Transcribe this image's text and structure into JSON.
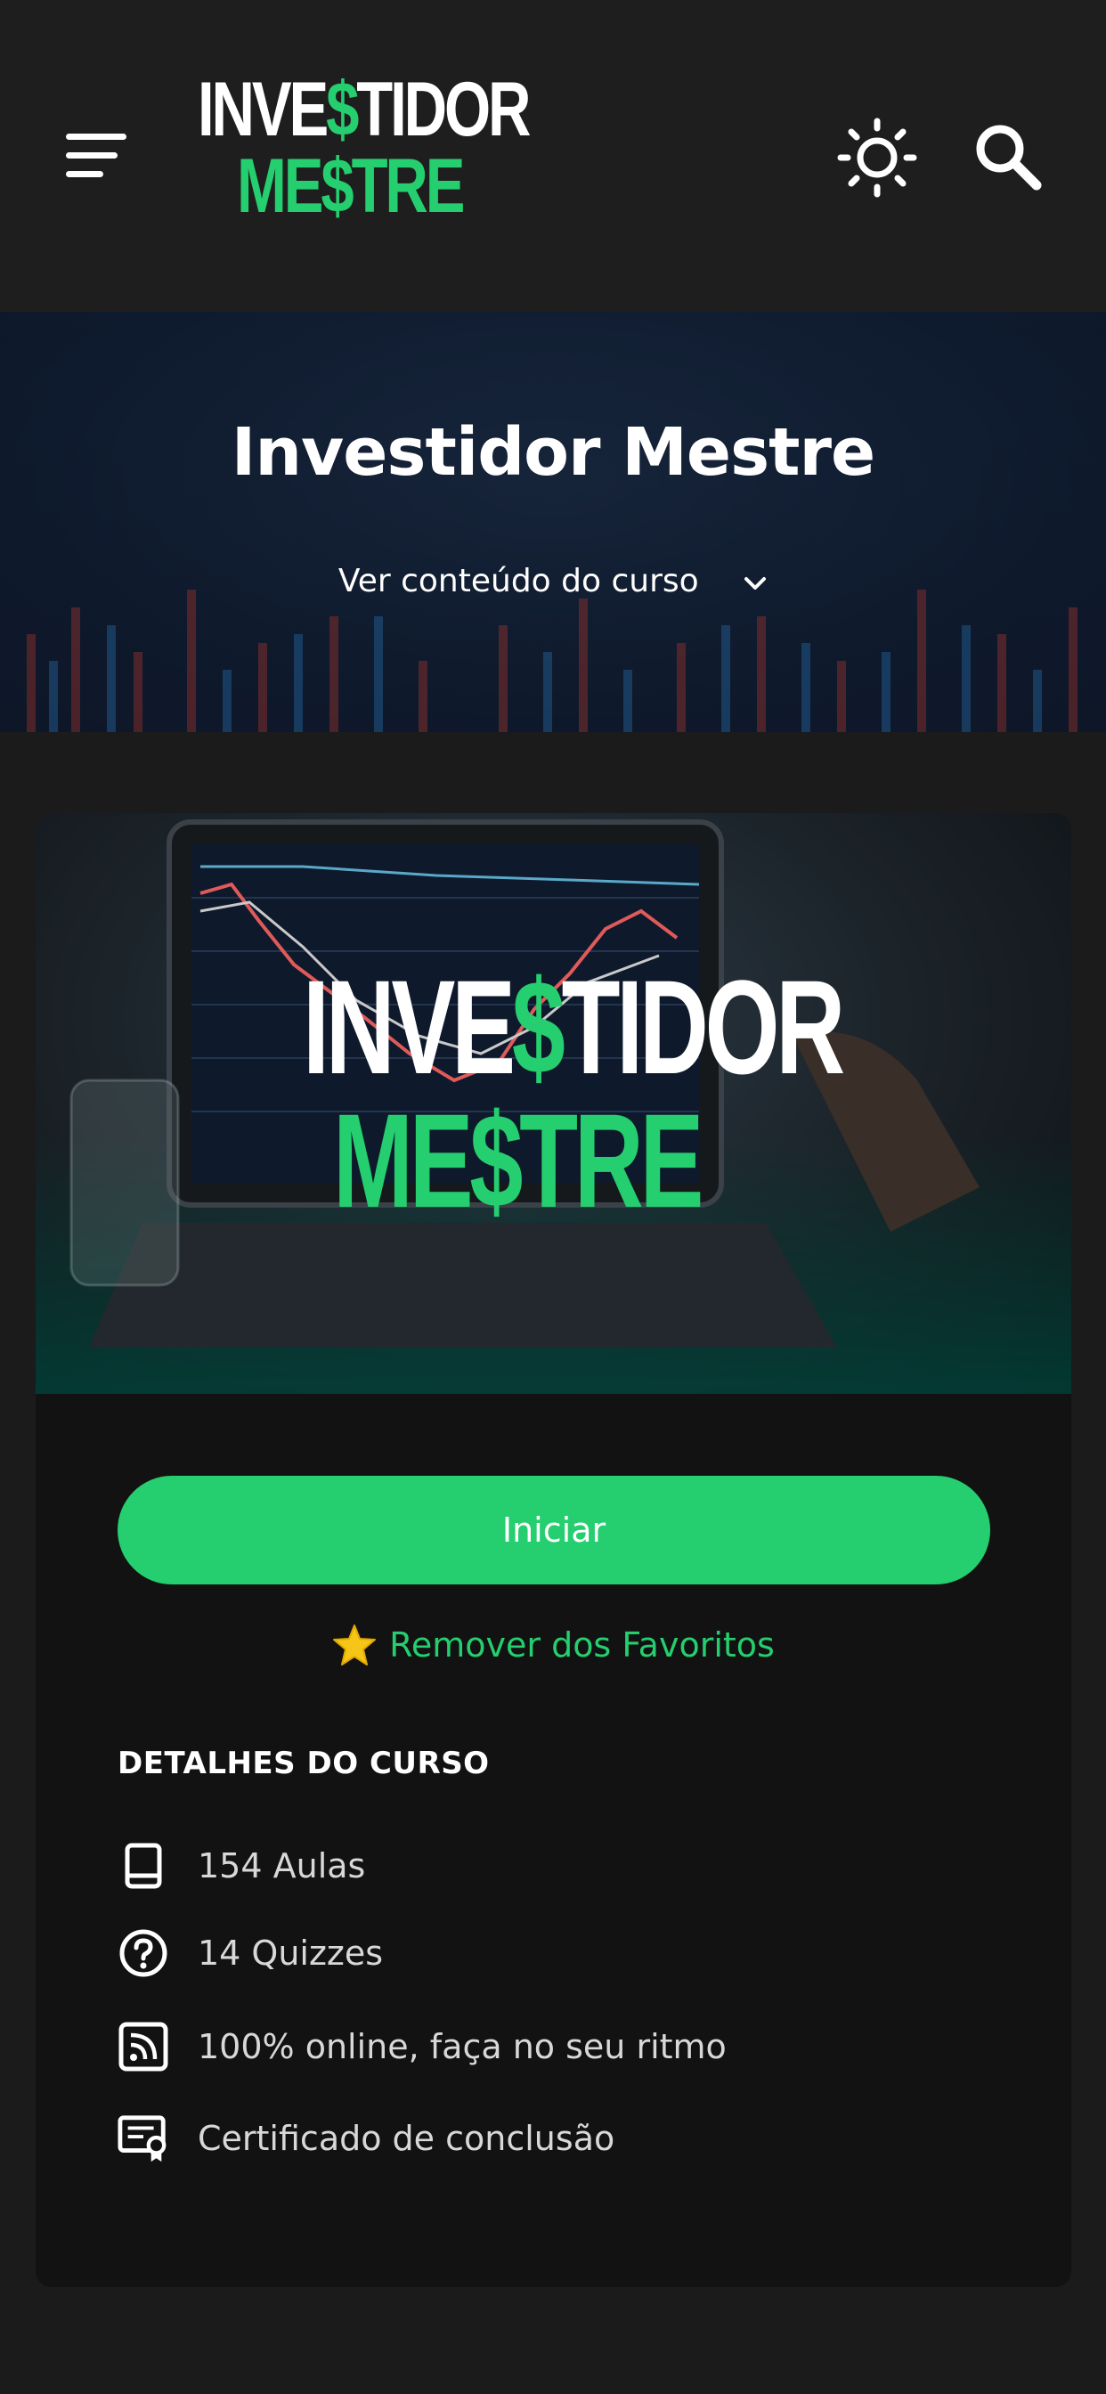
{
  "header": {
    "logo_top": [
      "INVE",
      "$",
      "TIDOR"
    ],
    "logo_bottom": [
      "ME",
      "$",
      "TRE"
    ],
    "icons": [
      "menu-icon",
      "sun-icon",
      "search-icon"
    ]
  },
  "banner": {
    "title": "Investidor Mestre",
    "toggle_label": "Ver conteúdo do curso"
  },
  "course": {
    "thumbnail_logo_top": [
      "INVE",
      "$",
      "TIDOR"
    ],
    "thumbnail_logo_bottom": [
      "ME",
      "$",
      "TRE"
    ],
    "start_label": "Iniciar",
    "favorite_label": "Remover dos Favoritos",
    "details_title": "DETALHES DO CURSO",
    "details": [
      {
        "icon": "book-icon",
        "text": "154 Aulas"
      },
      {
        "icon": "question-icon",
        "text": "14 Quizzes"
      },
      {
        "icon": "rss-icon",
        "text": "100% online, faça no seu ritmo"
      },
      {
        "icon": "certificate-icon",
        "text": "Certificado de conclusão"
      }
    ]
  },
  "colors": {
    "accent": "#25ce6e",
    "background": "#1b1b1b",
    "card": "#121212",
    "star": "#f5c518"
  }
}
